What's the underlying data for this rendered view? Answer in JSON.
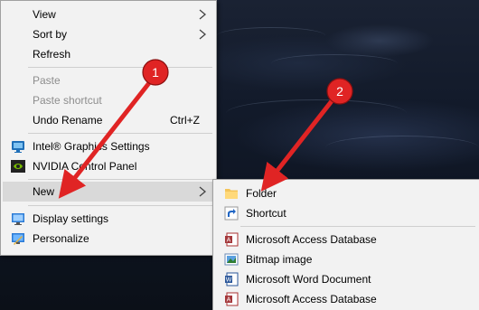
{
  "context_menu": {
    "items": [
      {
        "label": "View"
      },
      {
        "label": "Sort by"
      },
      {
        "label": "Refresh"
      },
      {
        "label": "Paste"
      },
      {
        "label": "Paste shortcut"
      },
      {
        "label": "Undo Rename",
        "shortcut": "Ctrl+Z"
      },
      {
        "label": "Intel® Graphics Settings"
      },
      {
        "label": "NVIDIA Control Panel"
      },
      {
        "label": "New"
      },
      {
        "label": "Display settings"
      },
      {
        "label": "Personalize"
      }
    ]
  },
  "new_submenu": {
    "items": [
      {
        "label": "Folder"
      },
      {
        "label": "Shortcut"
      },
      {
        "label": "Microsoft Access Database"
      },
      {
        "label": "Bitmap image"
      },
      {
        "label": "Microsoft Word Document"
      },
      {
        "label": "Microsoft Access Database"
      }
    ]
  },
  "annotations": {
    "marker_1": "1",
    "marker_2": "2",
    "color": "#e02424"
  }
}
